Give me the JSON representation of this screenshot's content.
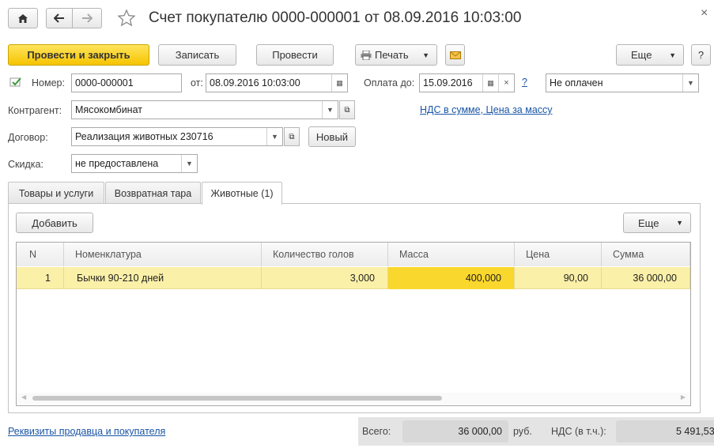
{
  "window": {
    "title": "Счет покупателю 0000-000001 от 08.09.2016 10:03:00",
    "close_label": "×"
  },
  "toolbar": {
    "post_close_label": "Провести и закрыть",
    "save_label": "Записать",
    "post_label": "Провести",
    "print_label": "Печать",
    "more_label": "Еще",
    "help_label": "?"
  },
  "form": {
    "number_label": "Номер:",
    "number_value": "0000-000001",
    "date_label": "от:",
    "date_value": "08.09.2016 10:03:00",
    "pay_until_label": "Оплата до:",
    "pay_until_value": "15.09.2016",
    "clear_label": "×",
    "help_label": "?",
    "payment_status": "Не оплачен",
    "counterparty_label": "Контрагент:",
    "counterparty_value": "Мясокомбинат",
    "vat_link": "НДС в сумме, Цена за массу",
    "contract_label": "Договор:",
    "contract_value": "Реализация животных 230716",
    "new_label": "Новый",
    "discount_label": "Скидка:",
    "discount_value": "не предоставлена"
  },
  "tabs": [
    {
      "label": "Товары и услуги"
    },
    {
      "label": "Возвратная тара"
    },
    {
      "label": "Животные (1)"
    }
  ],
  "table_toolbar": {
    "add_label": "Добавить",
    "more_label": "Еще"
  },
  "table": {
    "columns": [
      "N",
      "Номенклатура",
      "Количество голов",
      "Масса",
      "Цена",
      "Сумма"
    ],
    "rows": [
      {
        "n": "1",
        "item": "Бычки 90-210 дней",
        "heads": "3,000",
        "mass": "400,000",
        "price": "90,00",
        "sum": "36 000,00"
      }
    ]
  },
  "footer": {
    "requisites_link": "Реквизиты продавца и покупателя",
    "total_label": "Всего:",
    "total_value": "36 000,00",
    "currency": "руб.",
    "vat_label": "НДС (в т.ч.):",
    "vat_value": "5 491,53"
  },
  "colors": {
    "primary_button": "#f5c400",
    "selected_row": "#fbf0a8",
    "active_cell": "#f9d72d",
    "link": "#1a55a5"
  }
}
